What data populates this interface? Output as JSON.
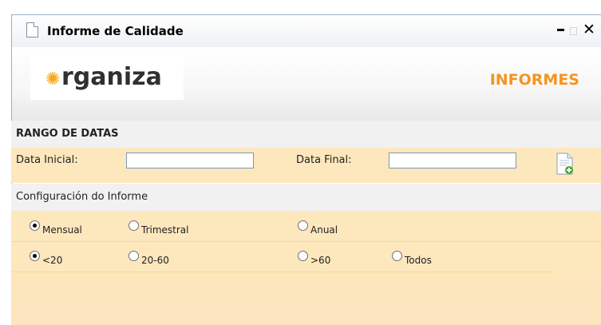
{
  "window": {
    "title": "Informe de Calidade",
    "controls": [
      "minimize",
      "maximize",
      "close"
    ]
  },
  "header": {
    "logo_text": "rganiza",
    "section_title": "INFORMES"
  },
  "date_range": {
    "heading": "RANGO DE DATAS",
    "start_label": "Data Inicial:",
    "start_value": "",
    "end_label": "Data Final:",
    "end_value": "",
    "report_button_icon": "new-document-icon"
  },
  "config": {
    "heading": "Configuración do Informe",
    "period_options": [
      {
        "label": "Mensual",
        "selected": true
      },
      {
        "label": "Trimestral",
        "selected": false
      },
      {
        "label": "Anual",
        "selected": false
      }
    ],
    "range_options": [
      {
        "label": "<20",
        "selected": true
      },
      {
        "label": "20-60",
        "selected": false
      },
      {
        "label": ">60",
        "selected": false
      },
      {
        "label": "Todos",
        "selected": false
      }
    ]
  },
  "colors": {
    "accent": "#f7931e",
    "row_background": "#fde7bd",
    "heading_background": "#f1f1f1"
  }
}
